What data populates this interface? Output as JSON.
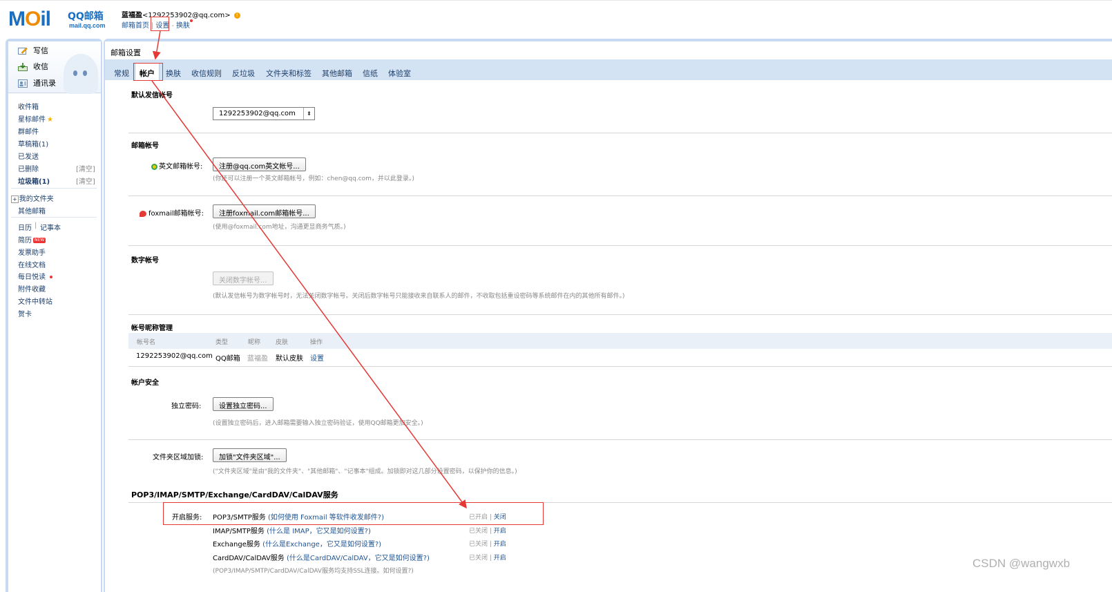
{
  "header": {
    "logo_main": "MOil",
    "logo_cn": "QQ邮箱",
    "logo_domain": "mail.qq.com",
    "user_name": "蓝福盈",
    "user_email": "<1292253902@qq.com>",
    "nav": {
      "home": "邮箱首页",
      "settings": "设置",
      "skin": "换肤"
    }
  },
  "quick_actions": {
    "compose": "写信",
    "receive": "收信",
    "contacts": "通讯录"
  },
  "sidebar": {
    "inbox": "收件箱",
    "starred": "星标邮件",
    "group": "群邮件",
    "drafts": "草稿箱",
    "drafts_count": "(1)",
    "sent": "已发送",
    "deleted": "已删除",
    "deleted_clear": "[清空]",
    "spam": "垃圾箱",
    "spam_count": "(1)",
    "spam_clear": "[清空]",
    "my_folders": "我的文件夹",
    "other_mail": "其他邮箱",
    "calendar": "日历",
    "notes": "记事本",
    "resume": "简历",
    "resume_badge": "NEW",
    "invoice": "发票助手",
    "docs": "在线文档",
    "daily": "每日悦读",
    "attachments": "附件收藏",
    "transfer": "文件中转站",
    "cards": "贺卡"
  },
  "main": {
    "page_title": "邮箱设置",
    "tabs": [
      "常规",
      "帐户",
      "换肤",
      "收信规则",
      "反垃圾",
      "文件夹和标签",
      "其他邮箱",
      "信纸",
      "体验室"
    ],
    "default_sender": {
      "title": "默认发信帐号",
      "value": "1292253902@qq.com"
    },
    "mail_accounts": {
      "title": "邮箱帐号",
      "english_label": "英文邮箱帐号:",
      "english_button": "注册@qq.com英文帐号...",
      "english_hint": "(你还可以注册一个英文邮箱帐号，例如：chen@qq.com，并以此登录。)",
      "foxmail_label": "foxmail邮箱帐号:",
      "foxmail_button": "注册foxmail.com邮箱帐号...",
      "foxmail_hint": "(使用@foxmail.com地址，沟通更显商务气质。)"
    },
    "digital_account": {
      "title": "数字帐号",
      "button": "关闭数字帐号...",
      "hint": "(默认发信帐号为数字帐号时，无法关闭数字帐号。关闭后数字帐号只能接收来自联系人的邮件，不收取包括重设密码等系统邮件在内的其他所有邮件。)"
    },
    "nickname": {
      "title": "帐号昵称管理",
      "columns": [
        "帐号名",
        "类型",
        "昵称",
        "皮肤",
        "操作"
      ],
      "row": {
        "account": "1292253902@qq.com",
        "type": "QQ邮箱",
        "nickname": "蓝福盈",
        "skin": "默认皮肤",
        "action": "设置"
      }
    },
    "security": {
      "title": "帐户安全",
      "password_label": "独立密码:",
      "password_button": "设置独立密码...",
      "password_hint": "(设置独立密码后，进入邮箱需要输入独立密码验证，使用QQ邮箱更加安全。)",
      "folder_label": "文件夹区域加锁:",
      "folder_button": "加锁\"文件夹区域\"...",
      "folder_hint": "(\"文件夹区域\"是由\"我的文件夹\"、\"其他邮箱\"、\"记事本\"组成。加锁即对这几部分设置密码，以保护你的信息。)"
    },
    "services": {
      "title": "POP3/IMAP/SMTP/Exchange/CardDAV/CalDAV服务",
      "enable_label": "开启服务:",
      "items": [
        {
          "name": "POP3/SMTP服务",
          "help": "(如何使用 Foxmail 等软件收发邮件?)",
          "status": "已开启",
          "action": "关闭"
        },
        {
          "name": "IMAP/SMTP服务",
          "help": "(什么是 IMAP，它又是如何设置?)",
          "status": "已关闭",
          "action": "开启"
        },
        {
          "name": "Exchange服务",
          "help": "(什么是Exchange，它又是如何设置?)",
          "status": "已关闭",
          "action": "开启"
        },
        {
          "name": "CardDAV/CalDAV服务",
          "help": "(什么是CardDAV/CalDAV，它又是如何设置?)",
          "status": "已关闭",
          "action": "开启"
        }
      ],
      "footer": "(POP3/IMAP/SMTP/CardDAV/CalDAV服务均支持SSL连接。如何设置?)"
    }
  },
  "watermark": "CSDN @wangwxb",
  "colors": {
    "frame": "#c7daf1",
    "tabbar": "#d4e3f4",
    "link": "#1e5494",
    "annotation": "#e53935"
  }
}
